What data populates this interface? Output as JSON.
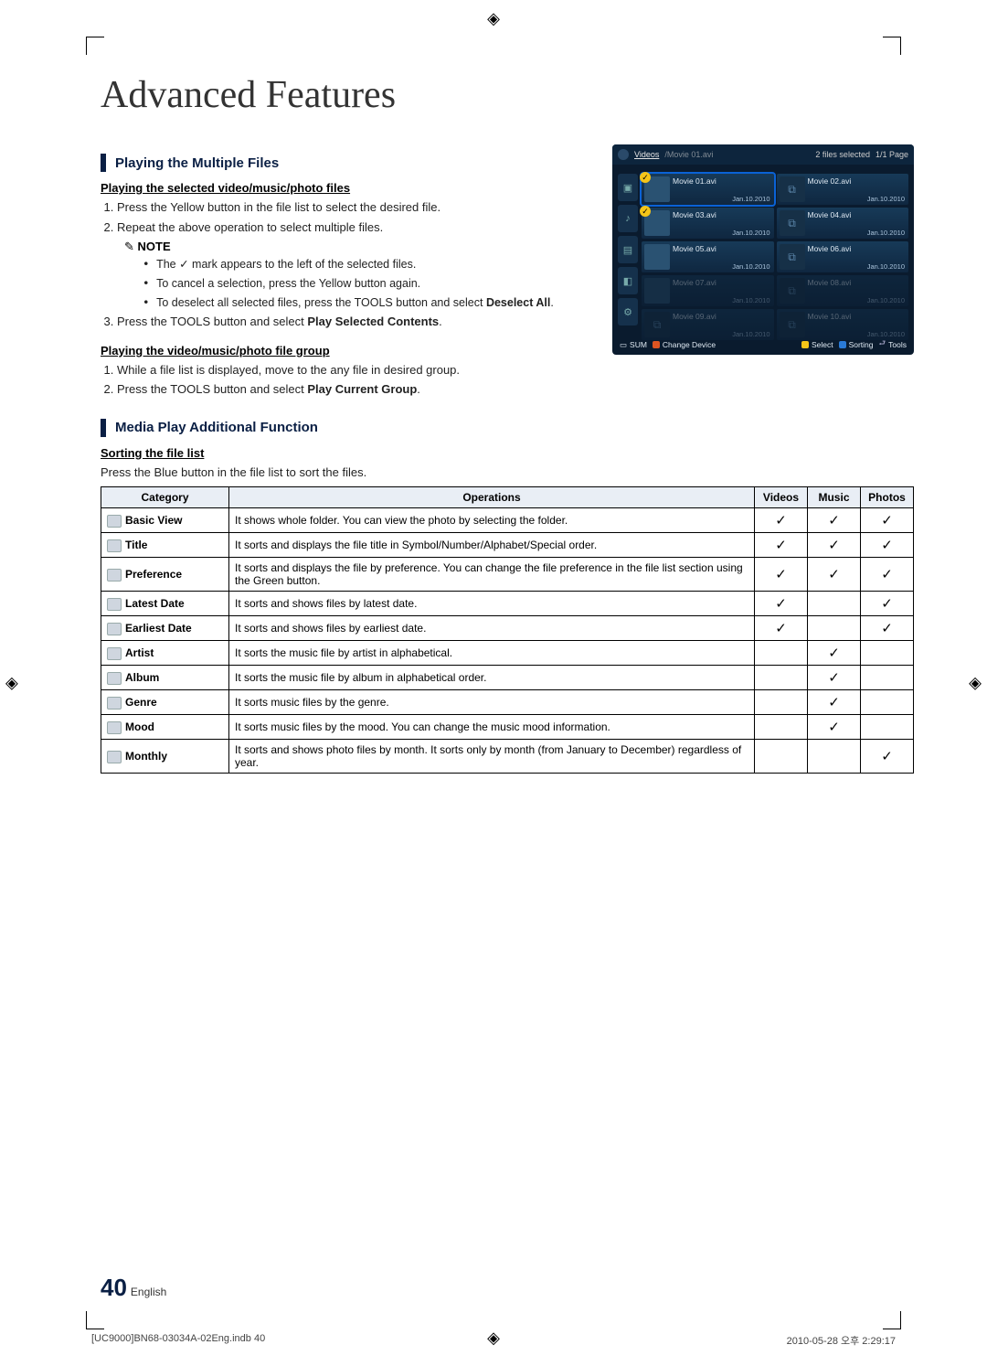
{
  "page": {
    "title": "Advanced Features",
    "pageNumber": "40",
    "pageLang": "English"
  },
  "sectionA": {
    "header": "Playing the Multiple Files",
    "sub1": "Playing the selected video/music/photo files",
    "step1": "Press the Yellow button in the file list to select the desired file.",
    "step2": "Repeat the above operation to select multiple files.",
    "noteLabel": "NOTE",
    "note_a_pre": "The ",
    "note_a_post": " mark appears to the left of the selected files.",
    "note_b": "To cancel a selection, press the Yellow button again.",
    "note_c_pre": "To deselect all selected files, press the ",
    "note_c_tools": "TOOLS",
    "note_c_mid": " button and select ",
    "note_c_bold": "Deselect All",
    "note_c_post": ".",
    "step3_pre": "Press the TOOLS button and select ",
    "step3_bold": "Play Selected Contents",
    "step3_post": ".",
    "sub2": "Playing the video/music/photo file group",
    "g_step1": "While a file list is displayed, move to the any file in desired group.",
    "g_step2_pre": "Press the TOOLS button and select ",
    "g_step2_bold": "Play Current Group",
    "g_step2_post": "."
  },
  "sectionB": {
    "header": "Media Play Additional Function",
    "sortHead": "Sorting the file list",
    "sortBody": "Press the Blue button in the file list to sort the files.",
    "cols": {
      "cat": "Category",
      "ops": "Operations",
      "v": "Videos",
      "m": "Music",
      "p": "Photos"
    },
    "rows": [
      {
        "cat": "Basic View",
        "ops": "It shows whole folder. You can view the photo by selecting the folder.",
        "v": true,
        "m": true,
        "p": true
      },
      {
        "cat": "Title",
        "ops": "It sorts and displays the file title in Symbol/Number/Alphabet/Special order.",
        "v": true,
        "m": true,
        "p": true
      },
      {
        "cat": "Preference",
        "ops": "It sorts and displays the file by preference. You can change the file preference in the file list section using the Green button.",
        "v": true,
        "m": true,
        "p": true
      },
      {
        "cat": "Latest Date",
        "ops": "It sorts and shows files by latest date.",
        "v": true,
        "m": false,
        "p": true
      },
      {
        "cat": "Earliest Date",
        "ops": "It sorts and shows files by earliest date.",
        "v": true,
        "m": false,
        "p": true
      },
      {
        "cat": "Artist",
        "ops": "It sorts the music file by artist in alphabetical.",
        "v": false,
        "m": true,
        "p": false
      },
      {
        "cat": "Album",
        "ops": "It sorts the music file by album in alphabetical order.",
        "v": false,
        "m": true,
        "p": false
      },
      {
        "cat": "Genre",
        "ops": "It sorts music files by the genre.",
        "v": false,
        "m": true,
        "p": false
      },
      {
        "cat": "Mood",
        "ops": "It sorts music files by the mood. You can change the music mood information.",
        "v": false,
        "m": true,
        "p": false
      },
      {
        "cat": "Monthly",
        "ops": "It sorts and shows photo files by month. It sorts only by month (from January to December) regardless of year.",
        "v": false,
        "m": false,
        "p": true
      }
    ]
  },
  "mock": {
    "crumb1": "Videos",
    "crumb2": "/Movie 01.avi",
    "status": "2 files selected",
    "paging": "1/1 Page",
    "date": "Jan.10.2010",
    "files": [
      {
        "name": "Movie 01.avi",
        "sel": true,
        "high": true,
        "img": true
      },
      {
        "name": "Movie 02.avi",
        "sel": false,
        "high": false,
        "img": false
      },
      {
        "name": "Movie 03.avi",
        "sel": true,
        "high": false,
        "img": true
      },
      {
        "name": "Movie 04.avi",
        "sel": false,
        "high": false,
        "img": false
      },
      {
        "name": "Movie 05.avi",
        "sel": false,
        "high": false,
        "img": true
      },
      {
        "name": "Movie 06.avi",
        "sel": false,
        "high": false,
        "img": false
      },
      {
        "name": "Movie 07.avi",
        "sel": false,
        "high": false,
        "img": true,
        "dim": true
      },
      {
        "name": "Movie 08.avi",
        "sel": false,
        "high": false,
        "img": false,
        "dim": true
      },
      {
        "name": "Movie 09.avi",
        "sel": false,
        "high": false,
        "img": false,
        "dim": true
      },
      {
        "name": "Movie 10.avi",
        "sel": false,
        "high": false,
        "img": false,
        "dim": true
      }
    ],
    "footer": {
      "sum": "SUM",
      "a": "Change Device",
      "c": "Select",
      "d": "Sorting",
      "t": "Tools"
    }
  },
  "footer": {
    "left": "[UC9000]BN68-03034A-02Eng.indb   40",
    "right": "2010-05-28   오후 2:29:17"
  }
}
